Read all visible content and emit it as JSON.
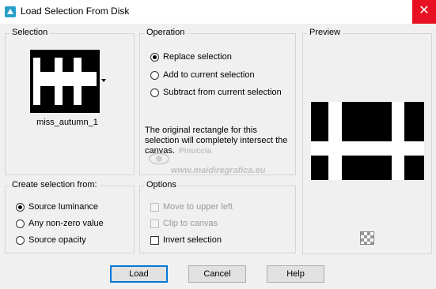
{
  "window": {
    "title": "Load Selection From Disk",
    "close_glyph": "✕"
  },
  "selection": {
    "group_label": "Selection",
    "file_name": "miss_autumn_1"
  },
  "operation": {
    "group_label": "Operation",
    "options": [
      "Replace selection",
      "Add to current selection",
      "Subtract from current selection"
    ],
    "selected": "Replace selection",
    "description": "The original rectangle for this selection will completely intersect the canvas."
  },
  "preview": {
    "group_label": "Preview"
  },
  "create_from": {
    "group_label": "Create selection from:",
    "options": [
      "Source luminance",
      "Any non-zero value",
      "Source opacity"
    ],
    "selected": "Source luminance"
  },
  "options": {
    "group_label": "Options",
    "items": [
      {
        "label": "Move to upper left",
        "checked": false,
        "enabled": false
      },
      {
        "label": "Clip to canvas",
        "checked": false,
        "enabled": false
      },
      {
        "label": "Invert selection",
        "checked": false,
        "enabled": true
      }
    ]
  },
  "buttons": {
    "load": "Load",
    "cancel": "Cancel",
    "help": "Help"
  },
  "watermark": {
    "line1": "Pinuccia",
    "line2": "www.maidiregrafica.eu"
  },
  "colors": {
    "close_bg": "#e81123",
    "app_icon": "#2aa0c8",
    "default_border": "#0078d7"
  }
}
